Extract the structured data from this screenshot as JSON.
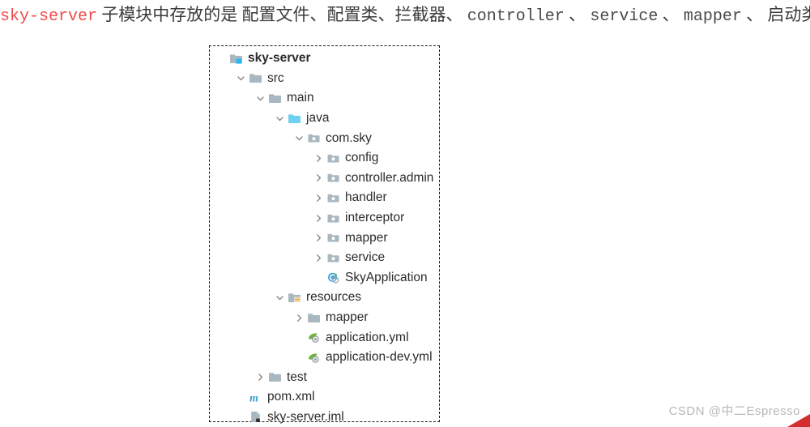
{
  "caption": {
    "module_name": "sky-server",
    "text_part_1": "子模块中存放的是",
    "text_part_2": "配置文件、配置类、拦截器、",
    "controller": "controller",
    "sep_1": "、",
    "service": "service",
    "sep_2": "、",
    "mapper": "mapper",
    "sep_3": "、",
    "text_part_3": "启动类等"
  },
  "colors": {
    "module_name_red": "#f04a4a",
    "caption_gray": "#3b3b3b",
    "folder_gray": "#a9b7c0",
    "folder_source_cyan": "#6fd0ef",
    "badge_cyan": "#29b6f6",
    "resources_orange": "#e8a33d",
    "maven_blue": "#3c9dd0",
    "spring_green": "#6db33f",
    "watermark_gray": "#b8b8b8",
    "corner_red": "#d32f2f"
  },
  "tree": {
    "nodes": [
      {
        "label": "sky-server",
        "depth": 0,
        "chevron": "none",
        "icon": "module-folder-icon",
        "bold": true
      },
      {
        "label": "src",
        "depth": 1,
        "chevron": "down",
        "icon": "folder-icon",
        "bold": false
      },
      {
        "label": "main",
        "depth": 2,
        "chevron": "down",
        "icon": "folder-icon",
        "bold": false
      },
      {
        "label": "java",
        "depth": 3,
        "chevron": "down",
        "icon": "source-root-folder-icon",
        "bold": false
      },
      {
        "label": "com.sky",
        "depth": 4,
        "chevron": "down",
        "icon": "package-icon",
        "bold": false
      },
      {
        "label": "config",
        "depth": 5,
        "chevron": "right",
        "icon": "package-icon",
        "bold": false
      },
      {
        "label": "controller.admin",
        "depth": 5,
        "chevron": "right",
        "icon": "package-icon",
        "bold": false
      },
      {
        "label": "handler",
        "depth": 5,
        "chevron": "right",
        "icon": "package-icon",
        "bold": false
      },
      {
        "label": "interceptor",
        "depth": 5,
        "chevron": "right",
        "icon": "package-icon",
        "bold": false
      },
      {
        "label": "mapper",
        "depth": 5,
        "chevron": "right",
        "icon": "package-icon",
        "bold": false
      },
      {
        "label": "service",
        "depth": 5,
        "chevron": "right",
        "icon": "package-icon",
        "bold": false
      },
      {
        "label": "SkyApplication",
        "depth": 5,
        "chevron": "none",
        "icon": "spring-boot-class-icon",
        "bold": false
      },
      {
        "label": "resources",
        "depth": 3,
        "chevron": "down",
        "icon": "resources-folder-icon",
        "bold": false
      },
      {
        "label": "mapper",
        "depth": 4,
        "chevron": "right",
        "icon": "folder-icon",
        "bold": false
      },
      {
        "label": "application.yml",
        "depth": 4,
        "chevron": "none",
        "icon": "spring-yaml-icon",
        "bold": false
      },
      {
        "label": "application-dev.yml",
        "depth": 4,
        "chevron": "none",
        "icon": "spring-yaml-icon",
        "bold": false
      },
      {
        "label": "test",
        "depth": 2,
        "chevron": "right",
        "icon": "folder-icon",
        "bold": false
      },
      {
        "label": "pom.xml",
        "depth": 1,
        "chevron": "none",
        "icon": "maven-icon",
        "bold": false
      },
      {
        "label": "sky-server.iml",
        "depth": 1,
        "chevron": "none",
        "icon": "iml-file-icon",
        "bold": false
      }
    ]
  },
  "watermark": {
    "text": "CSDN @中二Espresso"
  }
}
